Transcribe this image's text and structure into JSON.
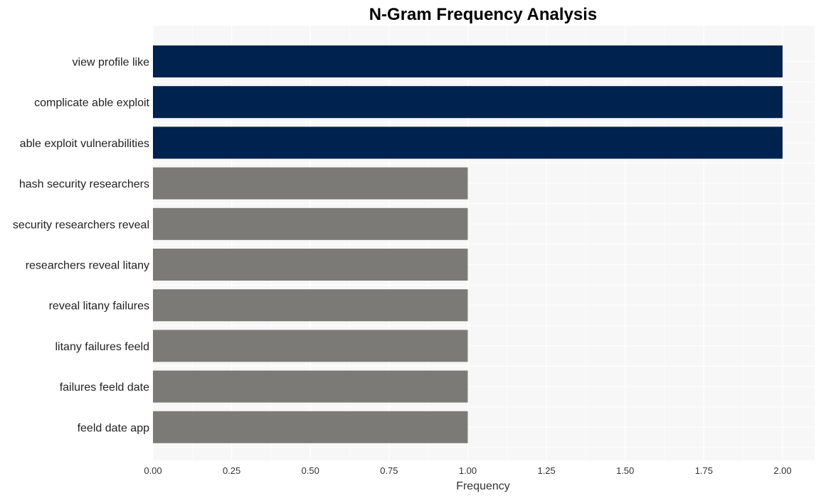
{
  "chart_data": {
    "type": "bar",
    "orientation": "horizontal",
    "title": "N-Gram Frequency Analysis",
    "xlabel": "Frequency",
    "ylabel": "",
    "xlim": [
      0,
      2.1
    ],
    "xticks": [
      "0.00",
      "0.25",
      "0.50",
      "0.75",
      "1.00",
      "1.25",
      "1.50",
      "1.75",
      "2.00"
    ],
    "grid": true,
    "categories": [
      "view profile like",
      "complicate able exploit",
      "able exploit vulnerabilities",
      "hash security researchers",
      "security researchers reveal",
      "researchers reveal litany",
      "reveal litany failures",
      "litany failures feeld",
      "failures feeld date",
      "feeld date app"
    ],
    "values": [
      2,
      2,
      2,
      1,
      1,
      1,
      1,
      1,
      1,
      1
    ],
    "colors": {
      "highlight": "#00224e",
      "default": "#7b7a76",
      "plot_background": "#f7f7f7",
      "grid": "#ffffff"
    }
  }
}
